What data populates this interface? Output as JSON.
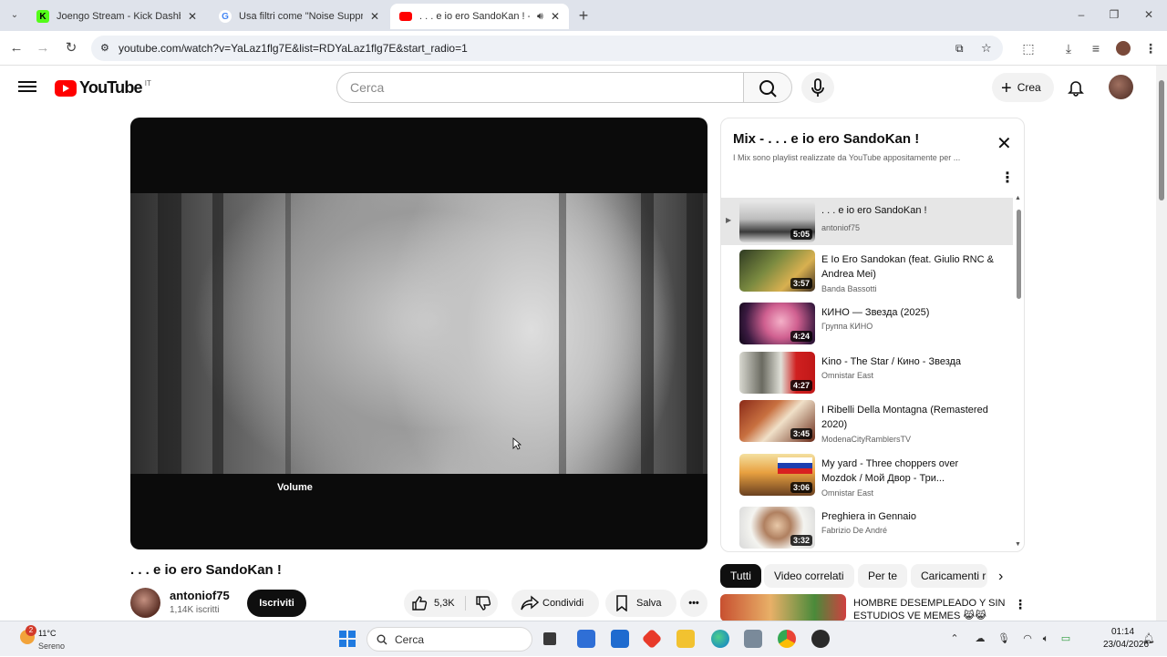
{
  "browser": {
    "tabs": [
      {
        "title": "Joengo Stream - Kick Dashboar",
        "favicon": "kick-icon",
        "color": "#53fc18"
      },
      {
        "title": "Usa filtri come \"Noise Suppress",
        "favicon": "google-icon",
        "color": "#4285f4"
      },
      {
        "title": ". . . e io ero SandoKan ! - Yo",
        "favicon": "youtube-icon",
        "color": "#ff0000"
      }
    ],
    "new_tab": "+",
    "url": "youtube.com/watch?v=YaLaz1flg7E&list=RDYaLaz1flg7E&start_radio=1",
    "window_controls": [
      "–",
      "❐",
      "✕"
    ]
  },
  "youtube": {
    "logo_text": "YouTube",
    "country": "IT",
    "search_placeholder": "Cerca",
    "create_label": "Crea"
  },
  "player": {
    "overlay_label": "Volume"
  },
  "video": {
    "title": ". . . e io ero SandoKan !",
    "channel": "antoniof75",
    "subscribers": "1,14K iscritti",
    "subscribe_label": "Iscriviti",
    "likes": "5,3K",
    "share_label": "Condividi",
    "save_label": "Salva",
    "more_label": "•••"
  },
  "playlist": {
    "title": "Mix - . . . e io ero SandoKan !",
    "description": "I Mix sono playlist realizzate da YouTube appositamente per ...",
    "items": [
      {
        "title": ". . . e io ero SandoKan !",
        "channel": "antoniof75",
        "duration": "5:05",
        "current": true
      },
      {
        "title": "E Io Ero Sandokan (feat. Giulio RNC & Andrea Mei)",
        "channel": "Banda Bassotti",
        "duration": "3:57"
      },
      {
        "title": "КИНО — Звезда (2025)",
        "channel": "Группа КИНО",
        "duration": "4:24"
      },
      {
        "title": "Kino - The Star / Кино - Звезда",
        "channel": "Omnistar East",
        "duration": "4:27"
      },
      {
        "title": "I Ribelli Della Montagna (Remastered 2020)",
        "channel": "ModenaCityRamblersTV",
        "duration": "3:45"
      },
      {
        "title": "My yard - Three choppers over Mozdok / Мой Двор - Три...",
        "channel": "Omnistar East",
        "duration": "3:06"
      },
      {
        "title": "Preghiera in Gennaio",
        "channel": "Fabrizio De André",
        "duration": "3:32"
      }
    ]
  },
  "chips": [
    "Tutti",
    "Video correlati",
    "Per te",
    "Caricamenti r"
  ],
  "recommendation": {
    "title": "HOMBRE DESEMPLEADO Y SIN ESTUDIOS VE MEMES 😹😹"
  },
  "taskbar": {
    "weather_temp": "11°C",
    "weather_cond": "Sereno",
    "weather_badge": "2",
    "search_placeholder": "Cerca",
    "time": "01:14",
    "date": "23/04/2026"
  }
}
